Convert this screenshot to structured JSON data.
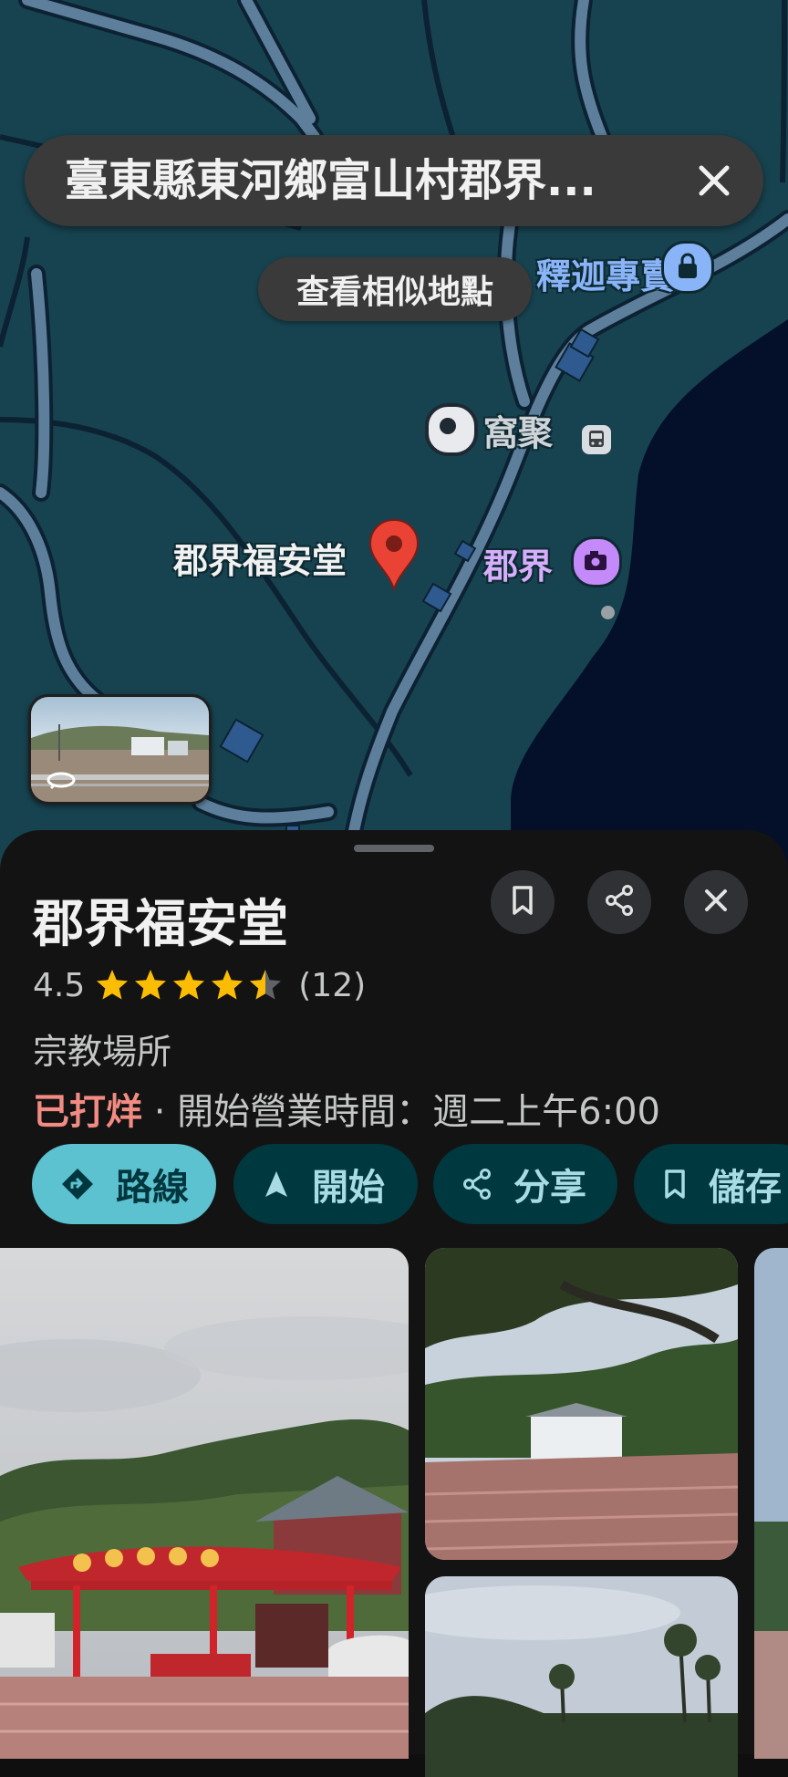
{
  "map": {
    "search_text": "臺東縣東河鄉富山村郡界...",
    "similar_places_label": "查看相似地點",
    "labels": {
      "shop_partial": "釋迦專賣",
      "place_wojv": "窩聚",
      "pin_place": "郡界福安堂",
      "scenic": "郡界"
    },
    "icons": [
      "close-icon",
      "shopping-bag-icon",
      "bus-stop-icon",
      "red-pin-icon",
      "camera-icon",
      "street-view-icon"
    ]
  },
  "place": {
    "title": "郡界福安堂",
    "rating": "4.5",
    "stars_filled": 4.5,
    "review_count": "(12)",
    "category": "宗教場所",
    "status": "已打烊",
    "hours_text": " · 開始營業時間：週二上午6:00",
    "actions": {
      "directions": "路線",
      "start": "開始",
      "share": "分享",
      "save": "儲存"
    }
  },
  "colors": {
    "map_water": "#040f2a",
    "map_land": "#174350",
    "road": "#5d7f9b",
    "accent": "#5cc2d0",
    "star": "#fbbc04",
    "closed": "#f28b82"
  }
}
